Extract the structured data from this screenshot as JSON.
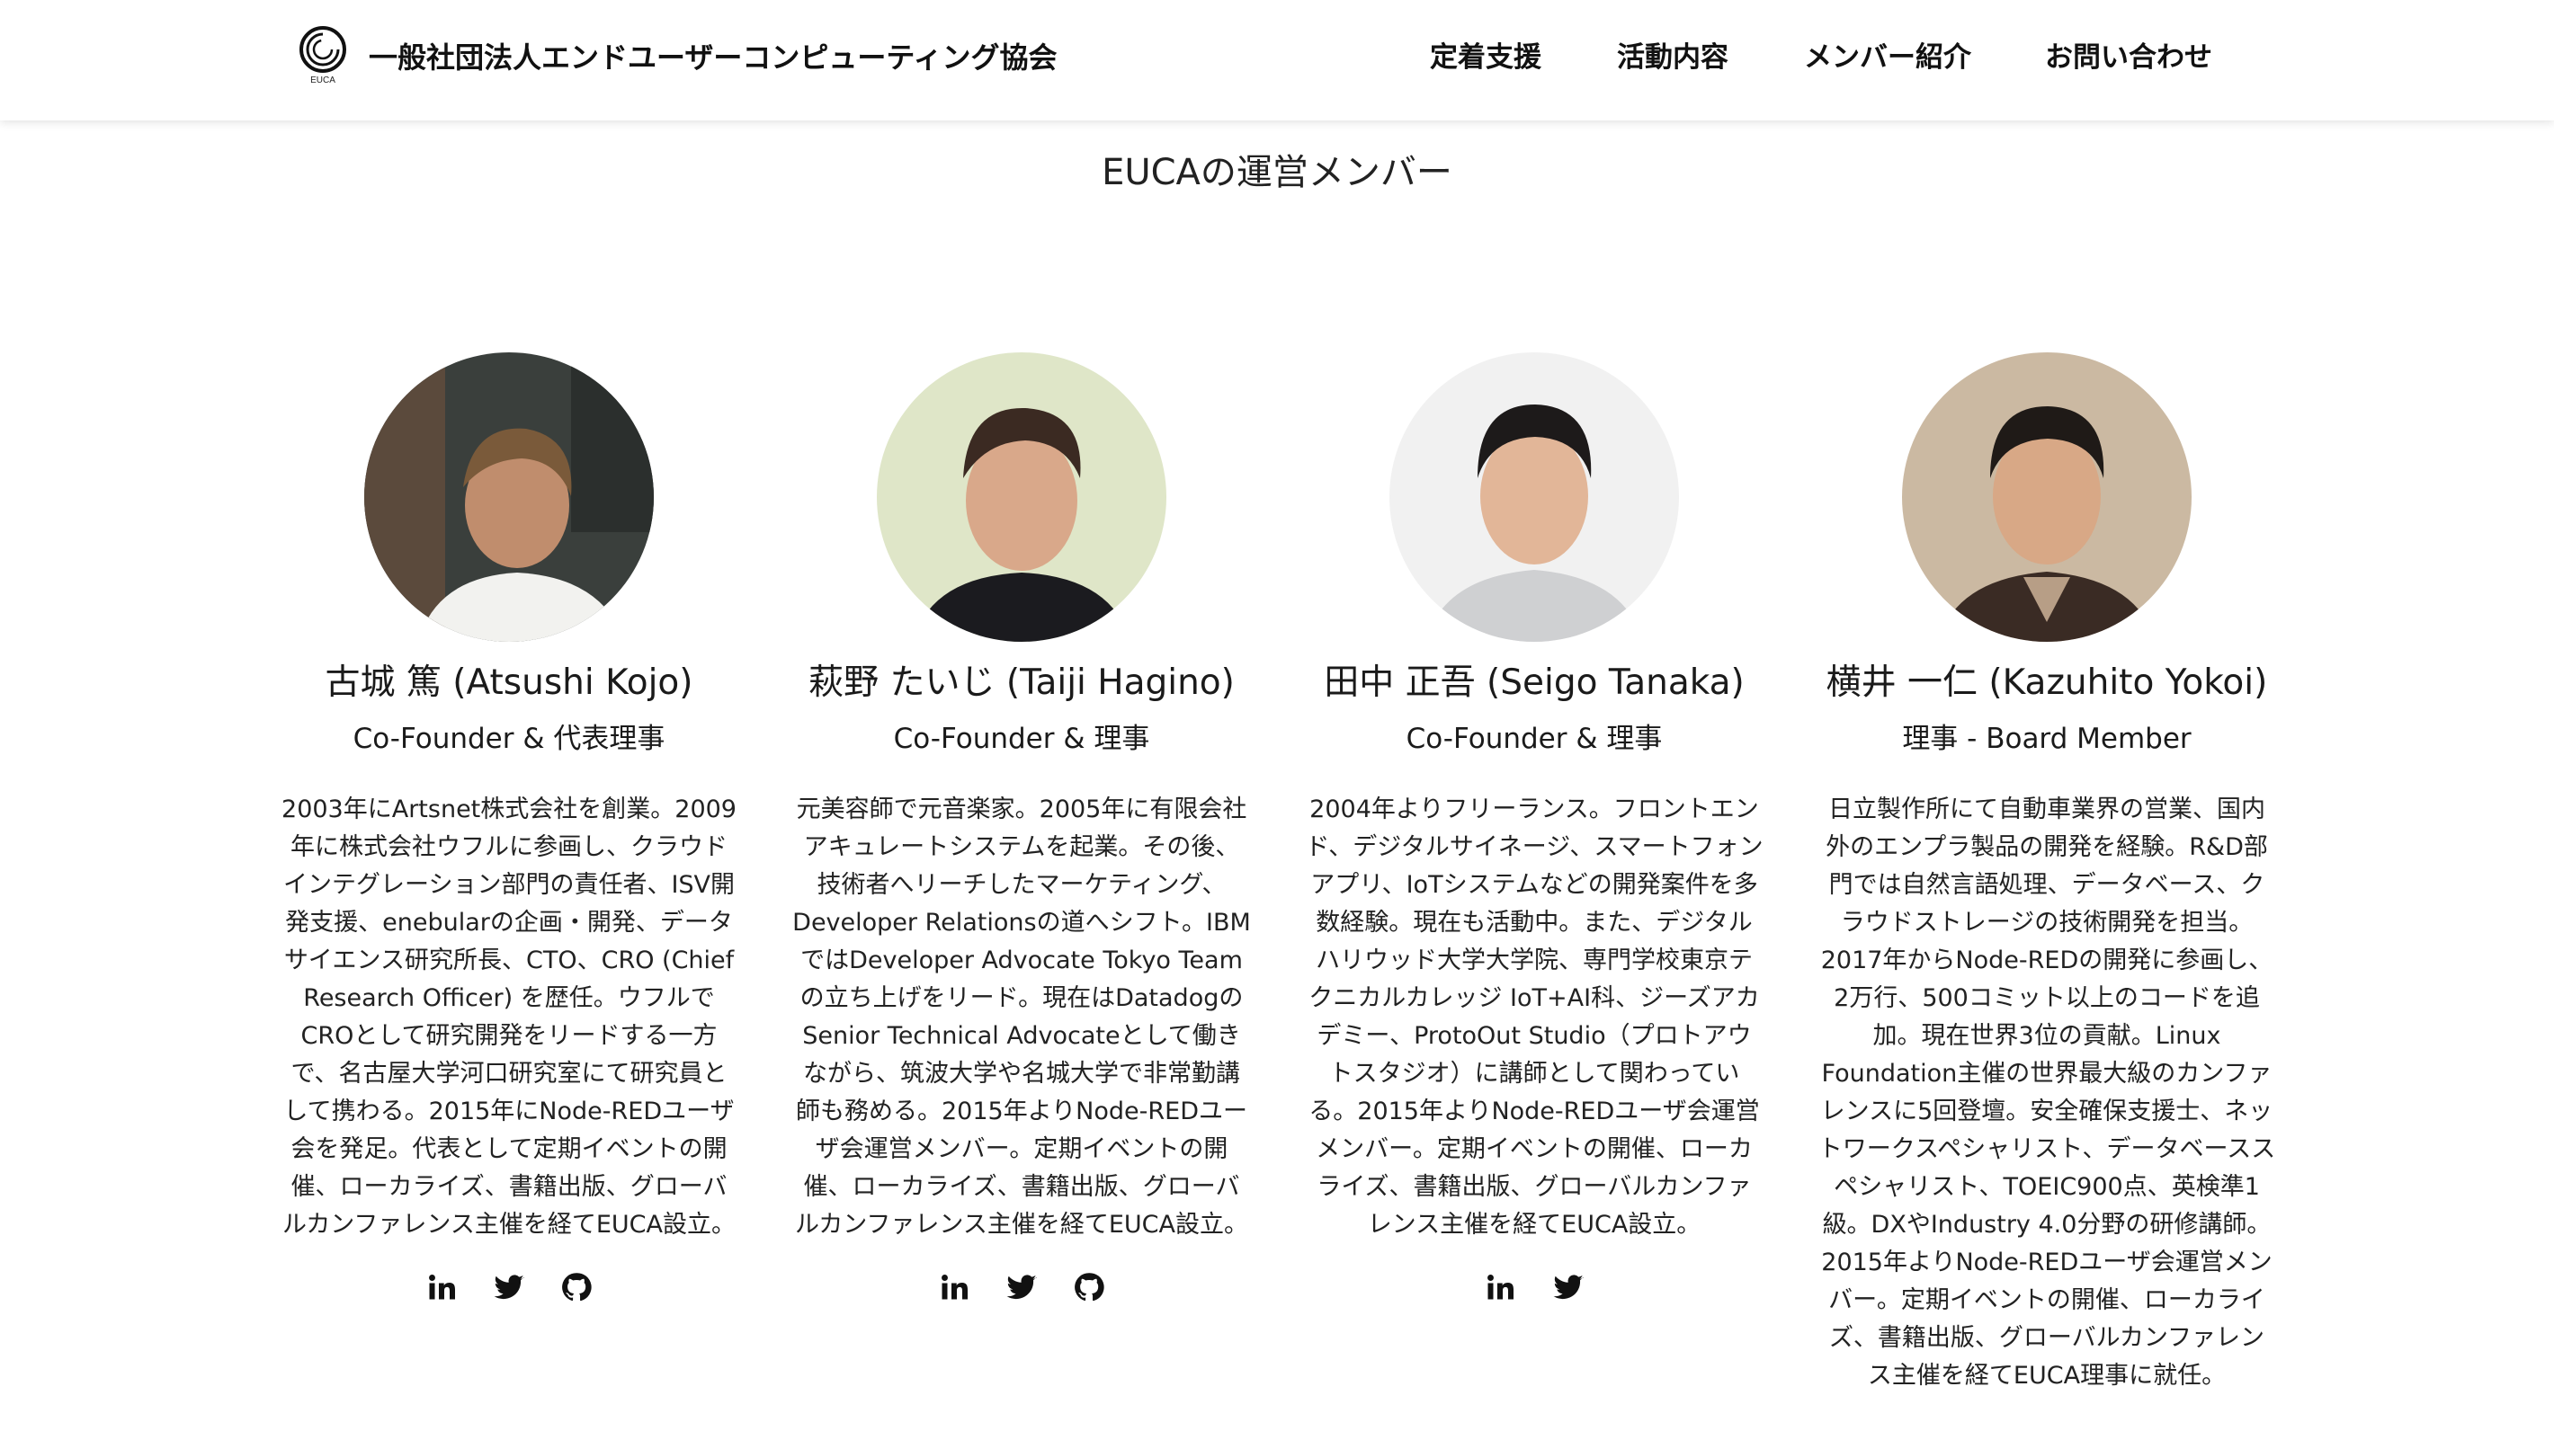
{
  "header": {
    "logo_text": "EUCA",
    "org_name": "一般社団法人エンドユーザーコンピューティング協会",
    "nav": [
      {
        "label": "定着支援"
      },
      {
        "label": "活動内容"
      },
      {
        "label": "メンバー紹介"
      },
      {
        "label": "お問い合わせ"
      }
    ]
  },
  "page_title": "EUCAの運営メンバー",
  "members": [
    {
      "name": "古城 篤 (Atsushi Kojo)",
      "role": "Co-Founder & 代表理事",
      "bio": "2003年にArtsnet株式会社を創業。2009年に株式会社ウフルに参画し、クラウドインテグレーション部門の責任者、ISV開発支援、enebularの企画・開発、データサイエンス研究所長、CTO、CRO (Chief Research Officer) を歴任。ウフルでCROとして研究開発をリードする一方で、名古屋大学河口研究室にて研究員として携わる。2015年にNode-REDユーザ会を発足。代表として定期イベントの開催、ローカライズ、書籍出版、グローバルカンファレンス主催を経てEUCA設立。",
      "socials": [
        "linkedin-icon",
        "twitter-icon",
        "github-icon"
      ]
    },
    {
      "name": "萩野 たいじ (Taiji Hagino)",
      "role": "Co-Founder & 理事",
      "bio": "元美容師で元音楽家。2005年に有限会社アキュレートシステムを起業。その後、技術者へリーチしたマーケティング、Developer Relationsの道へシフト。IBMではDeveloper Advocate Tokyo Teamの立ち上げをリード。現在はDatadogのSenior Technical Advocateとして働きながら、筑波大学や名城大学で非常勤講師も務める。2015年よりNode-REDユーザ会運営メンバー。定期イベントの開催、ローカライズ、書籍出版、グローバルカンファレンス主催を経てEUCA設立。",
      "socials": [
        "linkedin-icon",
        "twitter-icon",
        "github-icon"
      ]
    },
    {
      "name": "田中 正吾 (Seigo Tanaka)",
      "role": "Co-Founder & 理事",
      "bio": "2004年よりフリーランス。フロントエンド、デジタルサイネージ、スマートフォンアプリ、IoTシステムなどの開発案件を多数経験。現在も活動中。また、デジタルハリウッド大学大学院、専門学校東京テクニカルカレッジ IoT+AI科、ジーズアカデミー、ProtoOut Studio（プロトアウトスタジオ）に講師として関わっている。2015年よりNode-REDユーザ会運営メンバー。定期イベントの開催、ローカライズ、書籍出版、グローバルカンファレンス主催を経てEUCA設立。",
      "socials": [
        "linkedin-icon",
        "twitter-icon"
      ]
    },
    {
      "name": "横井 一仁 (Kazuhito Yokoi)",
      "role": "理事 - Board Member",
      "bio": "日立製作所にて自動車業界の営業、国内外のエンプラ製品の開発を経験。R&D部門では自然言語処理、データベース、クラウドストレージの技術開発を担当。2017年からNode-REDの開発に参画し、2万行、500コミット以上のコードを追加。現在世界3位の貢献。Linux Foundation主催の世界最大級のカンファレンスに5回登壇。安全確保支援士、ネットワークスペシャリスト、データベーススペシャリスト、TOEIC900点、英検準1級。DXやIndustry 4.0分野の研修講師。2015年よりNode-REDユーザ会運営メンバー。定期イベントの開催、ローカライズ、書籍出版、グローバルカンファレンス主催を経てEUCA理事に就任。",
      "socials": []
    }
  ]
}
